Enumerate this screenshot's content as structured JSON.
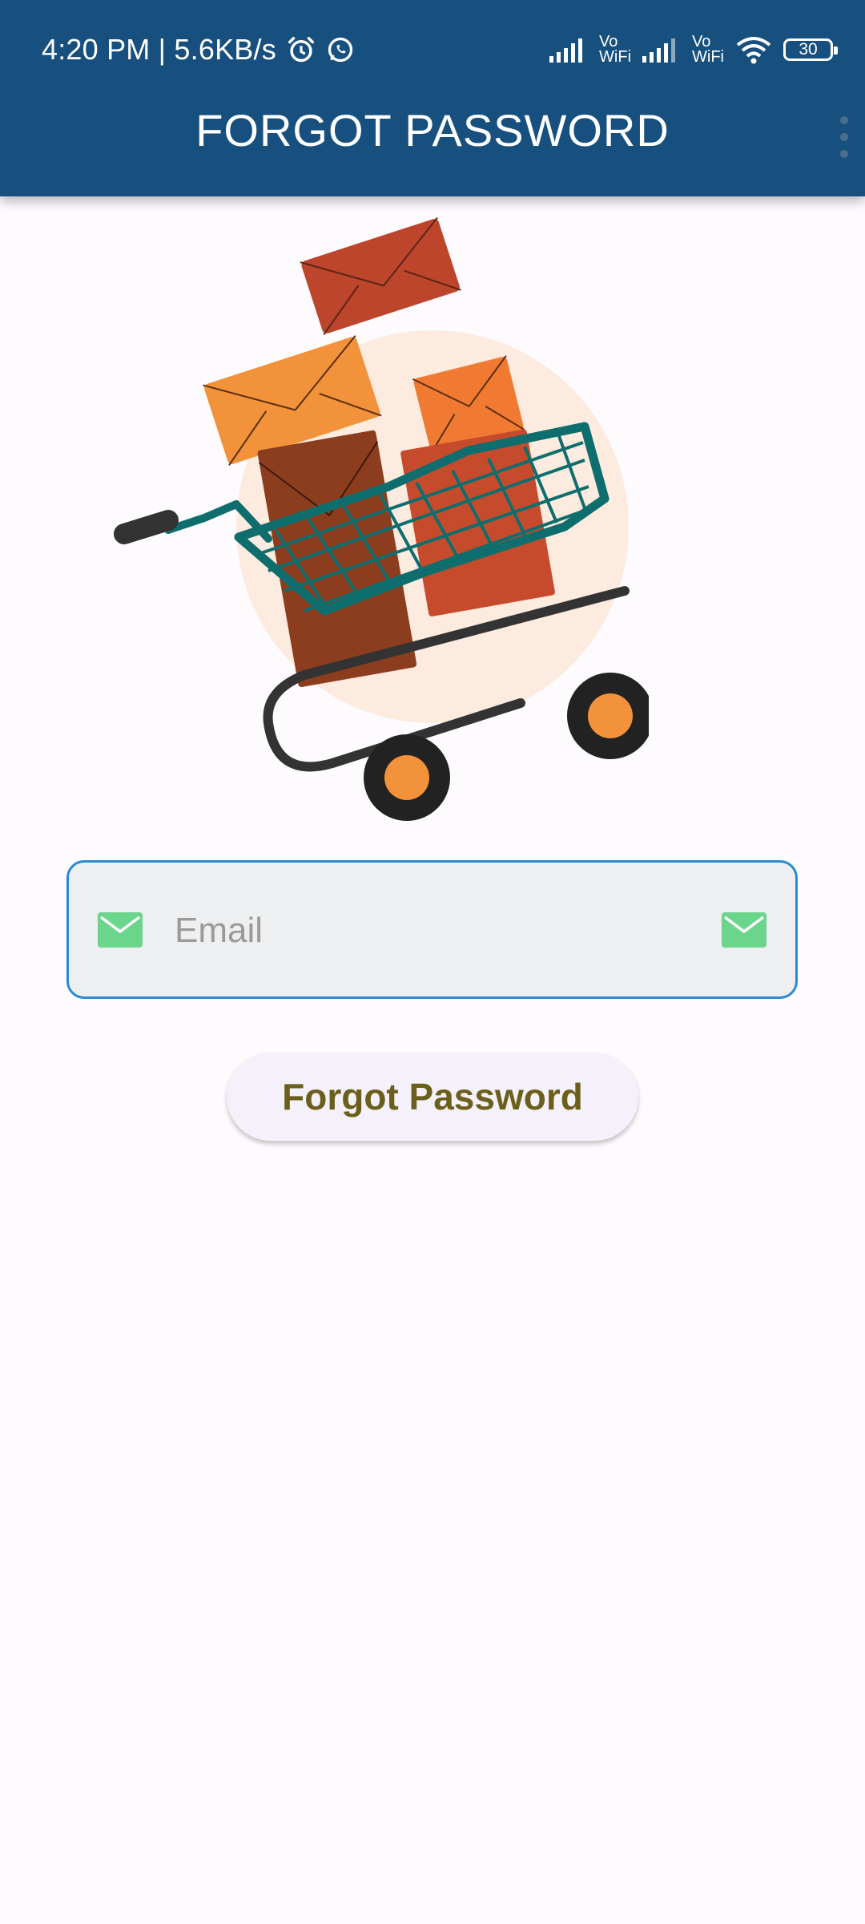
{
  "status_bar": {
    "time_speed": "4:20 PM | 5.6KB/s",
    "vowifi_1_top": "Vo",
    "vowifi_1_bottom": "WiFi",
    "vowifi_2_top": "Vo",
    "vowifi_2_bottom": "WiFi",
    "battery": "30",
    "icons": [
      "alarm-icon",
      "whatsapp-icon",
      "signal-icon",
      "signal-icon",
      "wifi-icon",
      "battery-icon"
    ]
  },
  "header": {
    "title": "FORGOT PASSWORD",
    "background_color": "#17507e",
    "menu_icon": "more-vert-icon"
  },
  "illustration": {
    "name": "shopping-cart-with-envelopes"
  },
  "form": {
    "email_placeholder": "Email",
    "email_value": "",
    "email_icon": "mail-icon",
    "email_icon_color": "#6bd58b",
    "border_color": "#2a8ad4"
  },
  "actions": {
    "forgot_password_label": "Forgot Password",
    "button_text_color": "#6b5f1c"
  }
}
